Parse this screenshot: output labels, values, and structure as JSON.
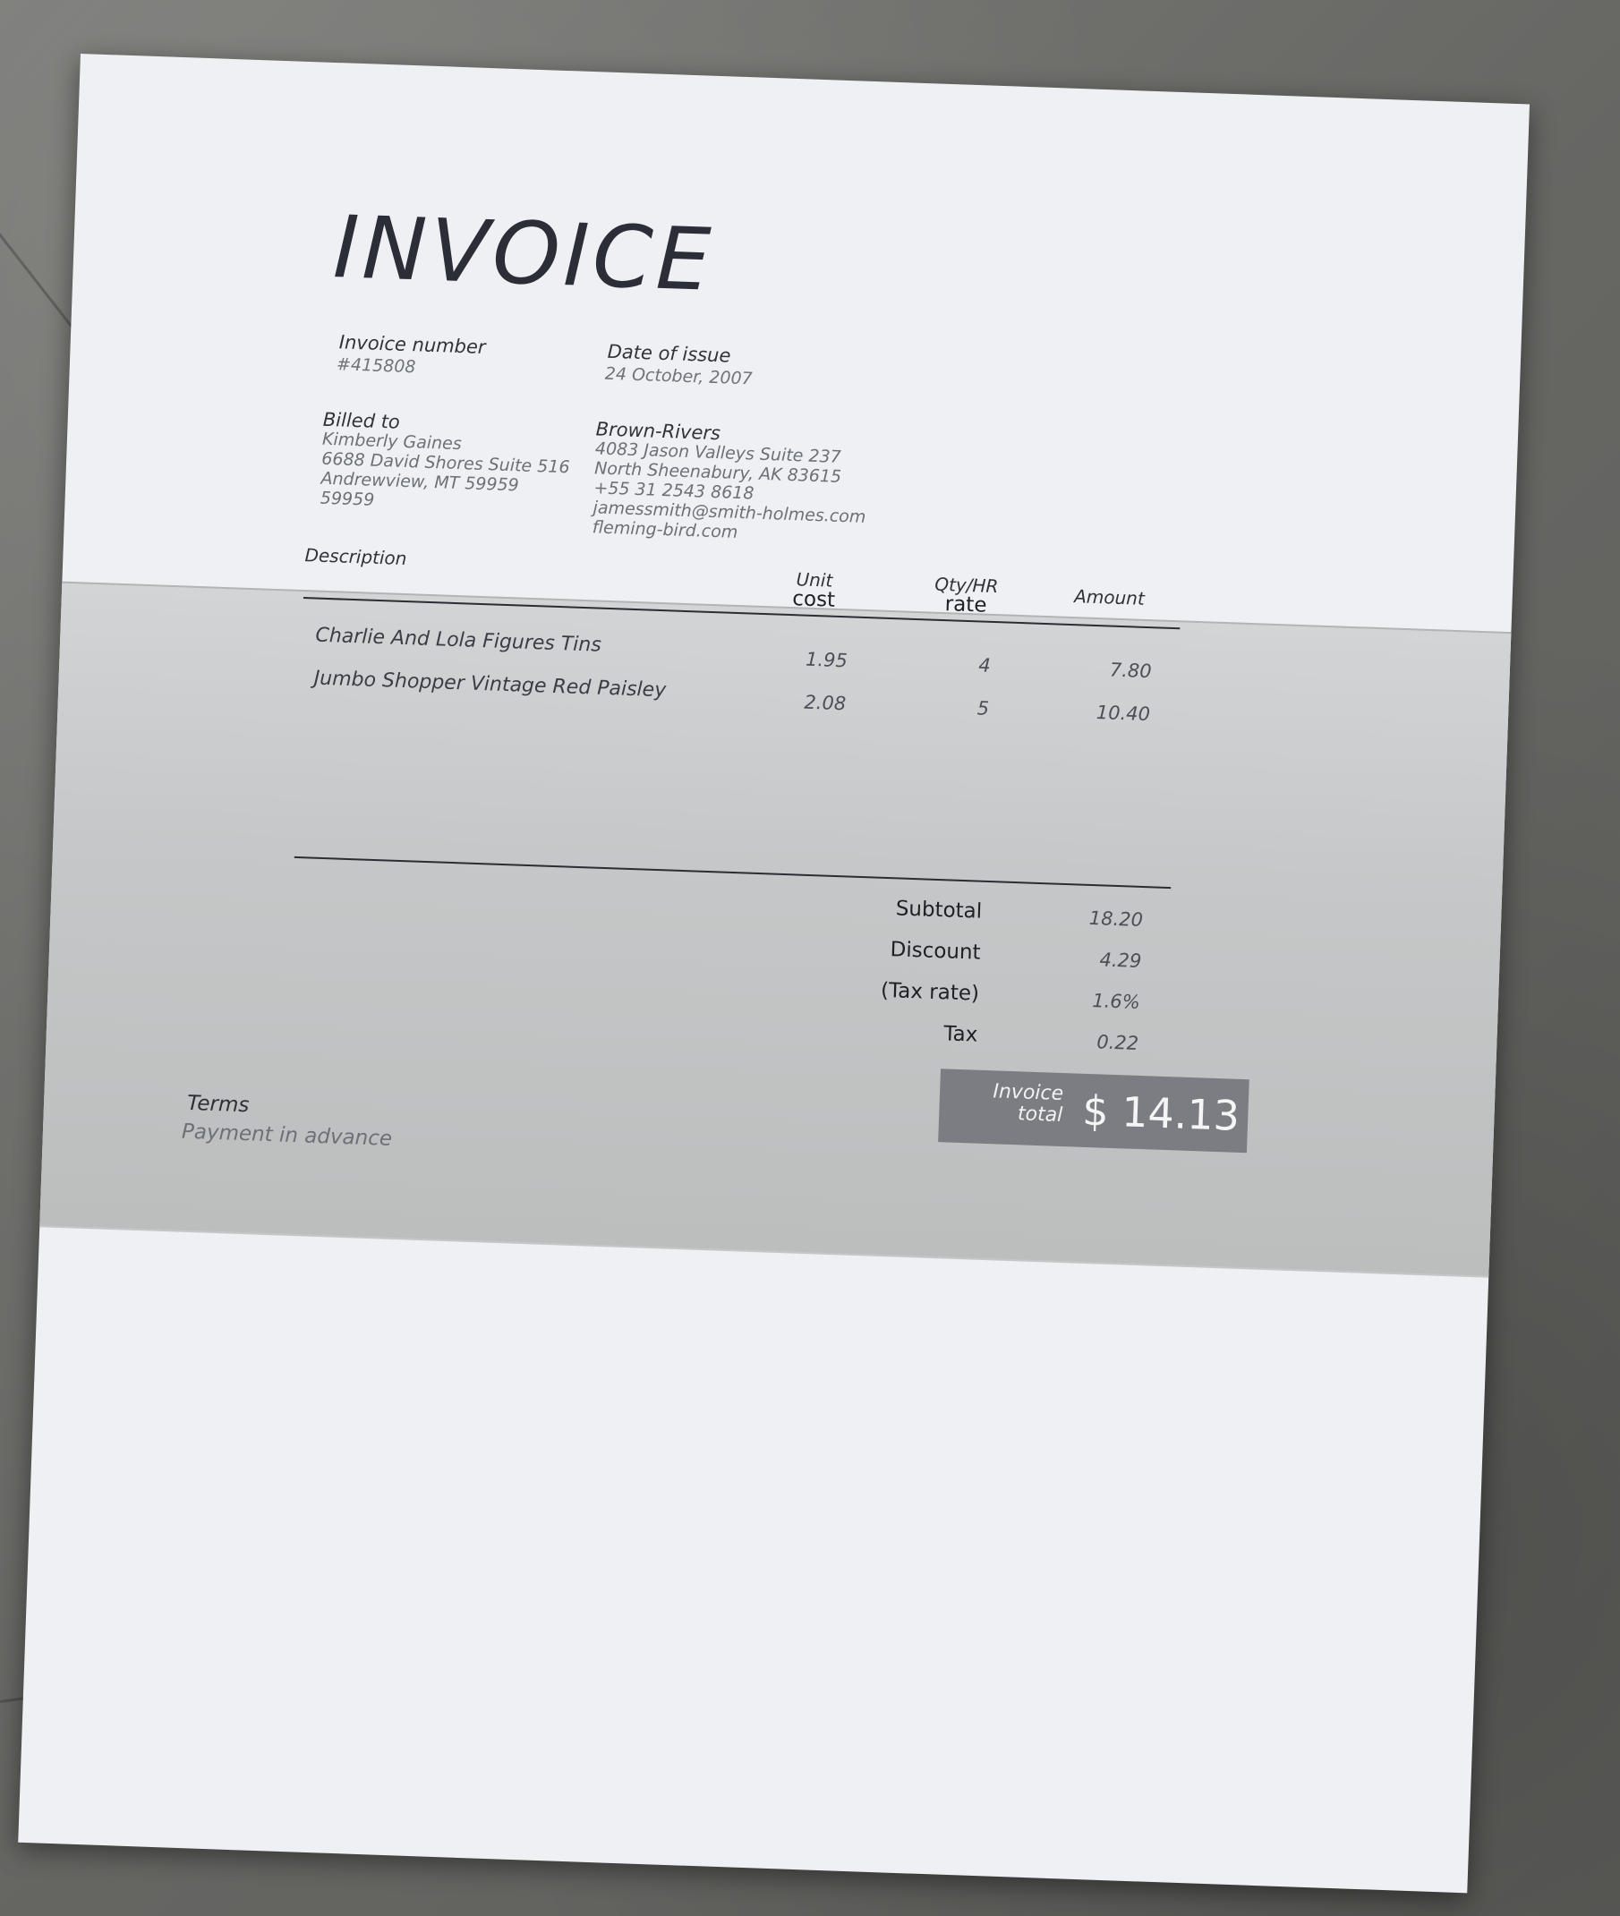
{
  "invoice": {
    "title": "INVOICE",
    "number_label": "Invoice number",
    "number": "#415808",
    "date_label": "Date of issue",
    "date": "24 October, 2007"
  },
  "billed_to": {
    "label": "Billed to",
    "name": "Kimberly Gaines",
    "street": "6688 David Shores Suite 516",
    "city": "Andrewview, MT 59959",
    "zip": "59959"
  },
  "seller": {
    "name": "Brown-Rivers",
    "street": "4083 Jason Valleys Suite 237",
    "city": "North Sheenabury, AK 83615",
    "phone": "+55 31 2543 8618",
    "email": "jamessmith@smith-holmes.com",
    "website": "fleming-bird.com"
  },
  "table": {
    "headers": {
      "description": "Description",
      "unit_top": "Unit",
      "unit_bottom": "cost",
      "qty_top": "Qty/HR",
      "qty_bottom": "rate",
      "amount": "Amount"
    },
    "items": [
      {
        "description": "Charlie And Lola Figures Tins",
        "unit_cost": "1.95",
        "qty": "4",
        "amount": "7.80"
      },
      {
        "description": "Jumbo Shopper Vintage Red Paisley",
        "unit_cost": "2.08",
        "qty": "5",
        "amount": "10.40"
      }
    ]
  },
  "summary": {
    "subtotal_label": "Subtotal",
    "subtotal": "18.20",
    "discount_label": "Discount",
    "discount": "4.29",
    "tax_rate_label": "(Tax rate)",
    "tax_rate": "1.6%",
    "tax_label": "Tax",
    "tax": "0.22"
  },
  "total": {
    "label_line1": "Invoice",
    "label_line2": "total",
    "value": "$ 14.13"
  },
  "terms": {
    "label": "Terms",
    "value": "Payment in advance"
  }
}
